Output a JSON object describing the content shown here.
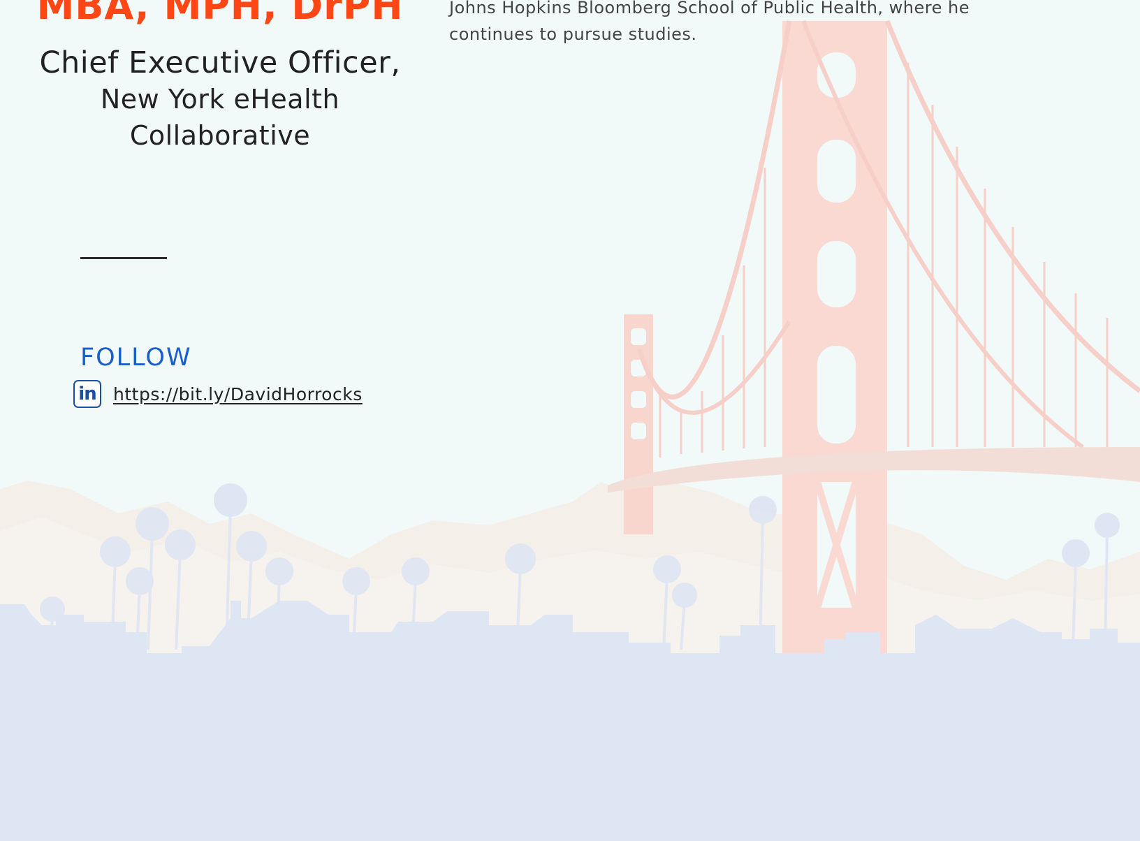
{
  "profile": {
    "credentials": "MBA, MPH, DrPH",
    "job_title": "Chief Executive Officer,",
    "organization": "New York eHealth Collaborative"
  },
  "bio": {
    "line_1": "Johns Hopkins Bloomberg School of Public Health, where he",
    "line_2": "continues to pursue studies."
  },
  "follow": {
    "heading": "FOLLOW",
    "linkedin_icon_text": "in",
    "linkedin_url": "https://bit.ly/DavidHorrocks"
  },
  "colors": {
    "credentials": "#ff4716",
    "heading_accent": "#1a5fc7",
    "linkedin_blue": "#1d4fa0",
    "background": "#f1f9f9",
    "skyline": "#dfe6f3",
    "bridge": "#f6d0c8"
  },
  "icons": {
    "social": "linkedin-icon"
  }
}
